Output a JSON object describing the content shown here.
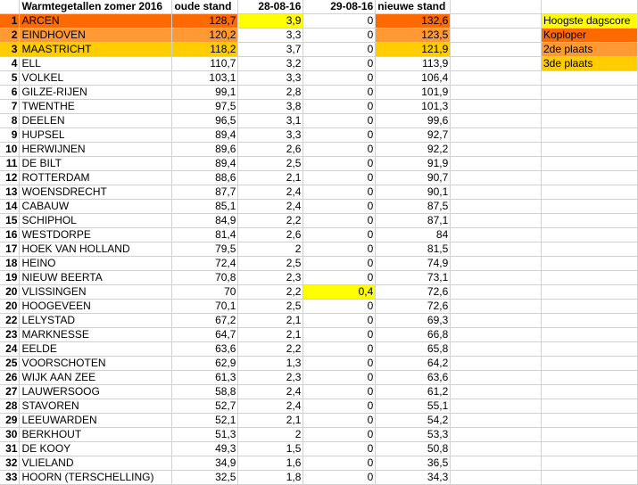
{
  "colors": {
    "yellow": "#ffff00",
    "rank1": "#ff6a00",
    "rank2": "#ff9933",
    "rank3": "#ffcc00"
  },
  "header": {
    "title": "Warmtegetallen zomer 2016",
    "col_old": "oude stand",
    "col_d1": "28-08-16",
    "col_d2": "29-08-16",
    "col_new": "nieuwe stand"
  },
  "legend": [
    {
      "label": "Hoogste dagscore",
      "color": "yellow"
    },
    {
      "label": "Koploper",
      "color": "rank1"
    },
    {
      "label": "2de plaats",
      "color": "rank2"
    },
    {
      "label": "3de plaats",
      "color": "rank3"
    }
  ],
  "rows": [
    {
      "rank": "1",
      "name": "ARCEN",
      "old": "128,7",
      "d1": "3,9",
      "d2": "0",
      "new": "132,6"
    },
    {
      "rank": "2",
      "name": "EINDHOVEN",
      "old": "120,2",
      "d1": "3,3",
      "d2": "0",
      "new": "123,5"
    },
    {
      "rank": "3",
      "name": "MAASTRICHT",
      "old": "118,2",
      "d1": "3,7",
      "d2": "0",
      "new": "121,9"
    },
    {
      "rank": "4",
      "name": "ELL",
      "old": "110,7",
      "d1": "3,2",
      "d2": "0",
      "new": "113,9"
    },
    {
      "rank": "5",
      "name": "VOLKEL",
      "old": "103,1",
      "d1": "3,3",
      "d2": "0",
      "new": "106,4"
    },
    {
      "rank": "6",
      "name": "GILZE-RIJEN",
      "old": "99,1",
      "d1": "2,8",
      "d2": "0",
      "new": "101,9"
    },
    {
      "rank": "7",
      "name": "TWENTHE",
      "old": "97,5",
      "d1": "3,8",
      "d2": "0",
      "new": "101,3"
    },
    {
      "rank": "8",
      "name": "DEELEN",
      "old": "96,5",
      "d1": "3,1",
      "d2": "0",
      "new": "99,6"
    },
    {
      "rank": "9",
      "name": "HUPSEL",
      "old": "89,4",
      "d1": "3,3",
      "d2": "0",
      "new": "92,7"
    },
    {
      "rank": "10",
      "name": "HERWIJNEN",
      "old": "89,6",
      "d1": "2,6",
      "d2": "0",
      "new": "92,2"
    },
    {
      "rank": "11",
      "name": "DE BILT",
      "old": "89,4",
      "d1": "2,5",
      "d2": "0",
      "new": "91,9"
    },
    {
      "rank": "12",
      "name": "ROTTERDAM",
      "old": "88,6",
      "d1": "2,1",
      "d2": "0",
      "new": "90,7"
    },
    {
      "rank": "13",
      "name": "WOENSDRECHT",
      "old": "87,7",
      "d1": "2,4",
      "d2": "0",
      "new": "90,1"
    },
    {
      "rank": "14",
      "name": "CABAUW",
      "old": "85,1",
      "d1": "2,4",
      "d2": "0",
      "new": "87,5"
    },
    {
      "rank": "15",
      "name": "SCHIPHOL",
      "old": "84,9",
      "d1": "2,2",
      "d2": "0",
      "new": "87,1"
    },
    {
      "rank": "16",
      "name": "WESTDORPE",
      "old": "81,4",
      "d1": "2,6",
      "d2": "0",
      "new": "84"
    },
    {
      "rank": "17",
      "name": "HOEK VAN HOLLAND",
      "old": "79,5",
      "d1": "2",
      "d2": "0",
      "new": "81,5"
    },
    {
      "rank": "18",
      "name": "HEINO",
      "old": "72,4",
      "d1": "2,5",
      "d2": "0",
      "new": "74,9"
    },
    {
      "rank": "19",
      "name": "NIEUW BEERTA",
      "old": "70,8",
      "d1": "2,3",
      "d2": "0",
      "new": "73,1"
    },
    {
      "rank": "20",
      "name": "VLISSINGEN",
      "old": "70",
      "d1": "2,2",
      "d2": "0,4",
      "new": "72,6"
    },
    {
      "rank": "20",
      "name": "HOOGEVEEN",
      "old": "70,1",
      "d1": "2,5",
      "d2": "0",
      "new": "72,6"
    },
    {
      "rank": "22",
      "name": "LELYSTAD",
      "old": "67,2",
      "d1": "2,1",
      "d2": "0",
      "new": "69,3"
    },
    {
      "rank": "23",
      "name": "MARKNESSE",
      "old": "64,7",
      "d1": "2,1",
      "d2": "0",
      "new": "66,8"
    },
    {
      "rank": "24",
      "name": "EELDE",
      "old": "63,6",
      "d1": "2,2",
      "d2": "0",
      "new": "65,8"
    },
    {
      "rank": "25",
      "name": "VOORSCHOTEN",
      "old": "62,9",
      "d1": "1,3",
      "d2": "0",
      "new": "64,2"
    },
    {
      "rank": "26",
      "name": "WIJK AAN ZEE",
      "old": "61,3",
      "d1": "2,3",
      "d2": "0",
      "new": "63,6"
    },
    {
      "rank": "27",
      "name": "LAUWERSOOG",
      "old": "58,8",
      "d1": "2,4",
      "d2": "0",
      "new": "61,2"
    },
    {
      "rank": "28",
      "name": "STAVOREN",
      "old": "52,7",
      "d1": "2,4",
      "d2": "0",
      "new": "55,1"
    },
    {
      "rank": "29",
      "name": "LEEUWARDEN",
      "old": "52,1",
      "d1": "2,1",
      "d2": "0",
      "new": "54,2"
    },
    {
      "rank": "30",
      "name": "BERKHOUT",
      "old": "51,3",
      "d1": "2",
      "d2": "0",
      "new": "53,3"
    },
    {
      "rank": "31",
      "name": "DE KOOY",
      "old": "49,3",
      "d1": "1,5",
      "d2": "0",
      "new": "50,8"
    },
    {
      "rank": "32",
      "name": "VLIELAND",
      "old": "34,9",
      "d1": "1,6",
      "d2": "0",
      "new": "36,5"
    },
    {
      "rank": "33",
      "name": "HOORN (TERSCHELLING)",
      "old": "32,5",
      "d1": "1,8",
      "d2": "0",
      "new": "34,3"
    }
  ]
}
